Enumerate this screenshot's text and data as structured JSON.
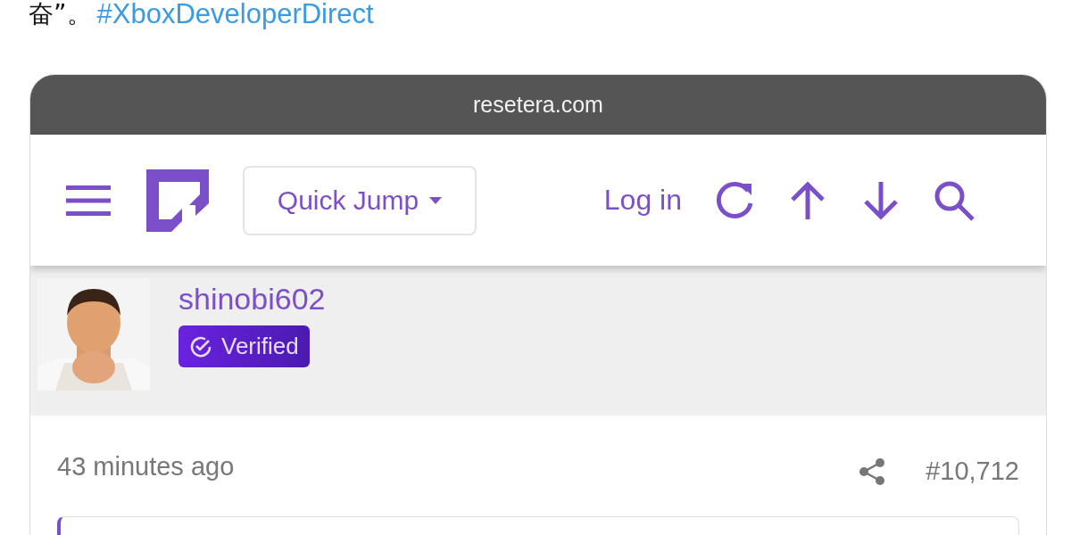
{
  "caption": {
    "text": "奋”。",
    "hashtag": "#XboxDeveloperDirect"
  },
  "browser": {
    "address": "resetera.com"
  },
  "navbar": {
    "quick_jump": "Quick Jump",
    "login": "Log in"
  },
  "post": {
    "username": "shinobi602",
    "badge": "Verified",
    "time": "43 minutes ago",
    "number": "#10,712"
  }
}
